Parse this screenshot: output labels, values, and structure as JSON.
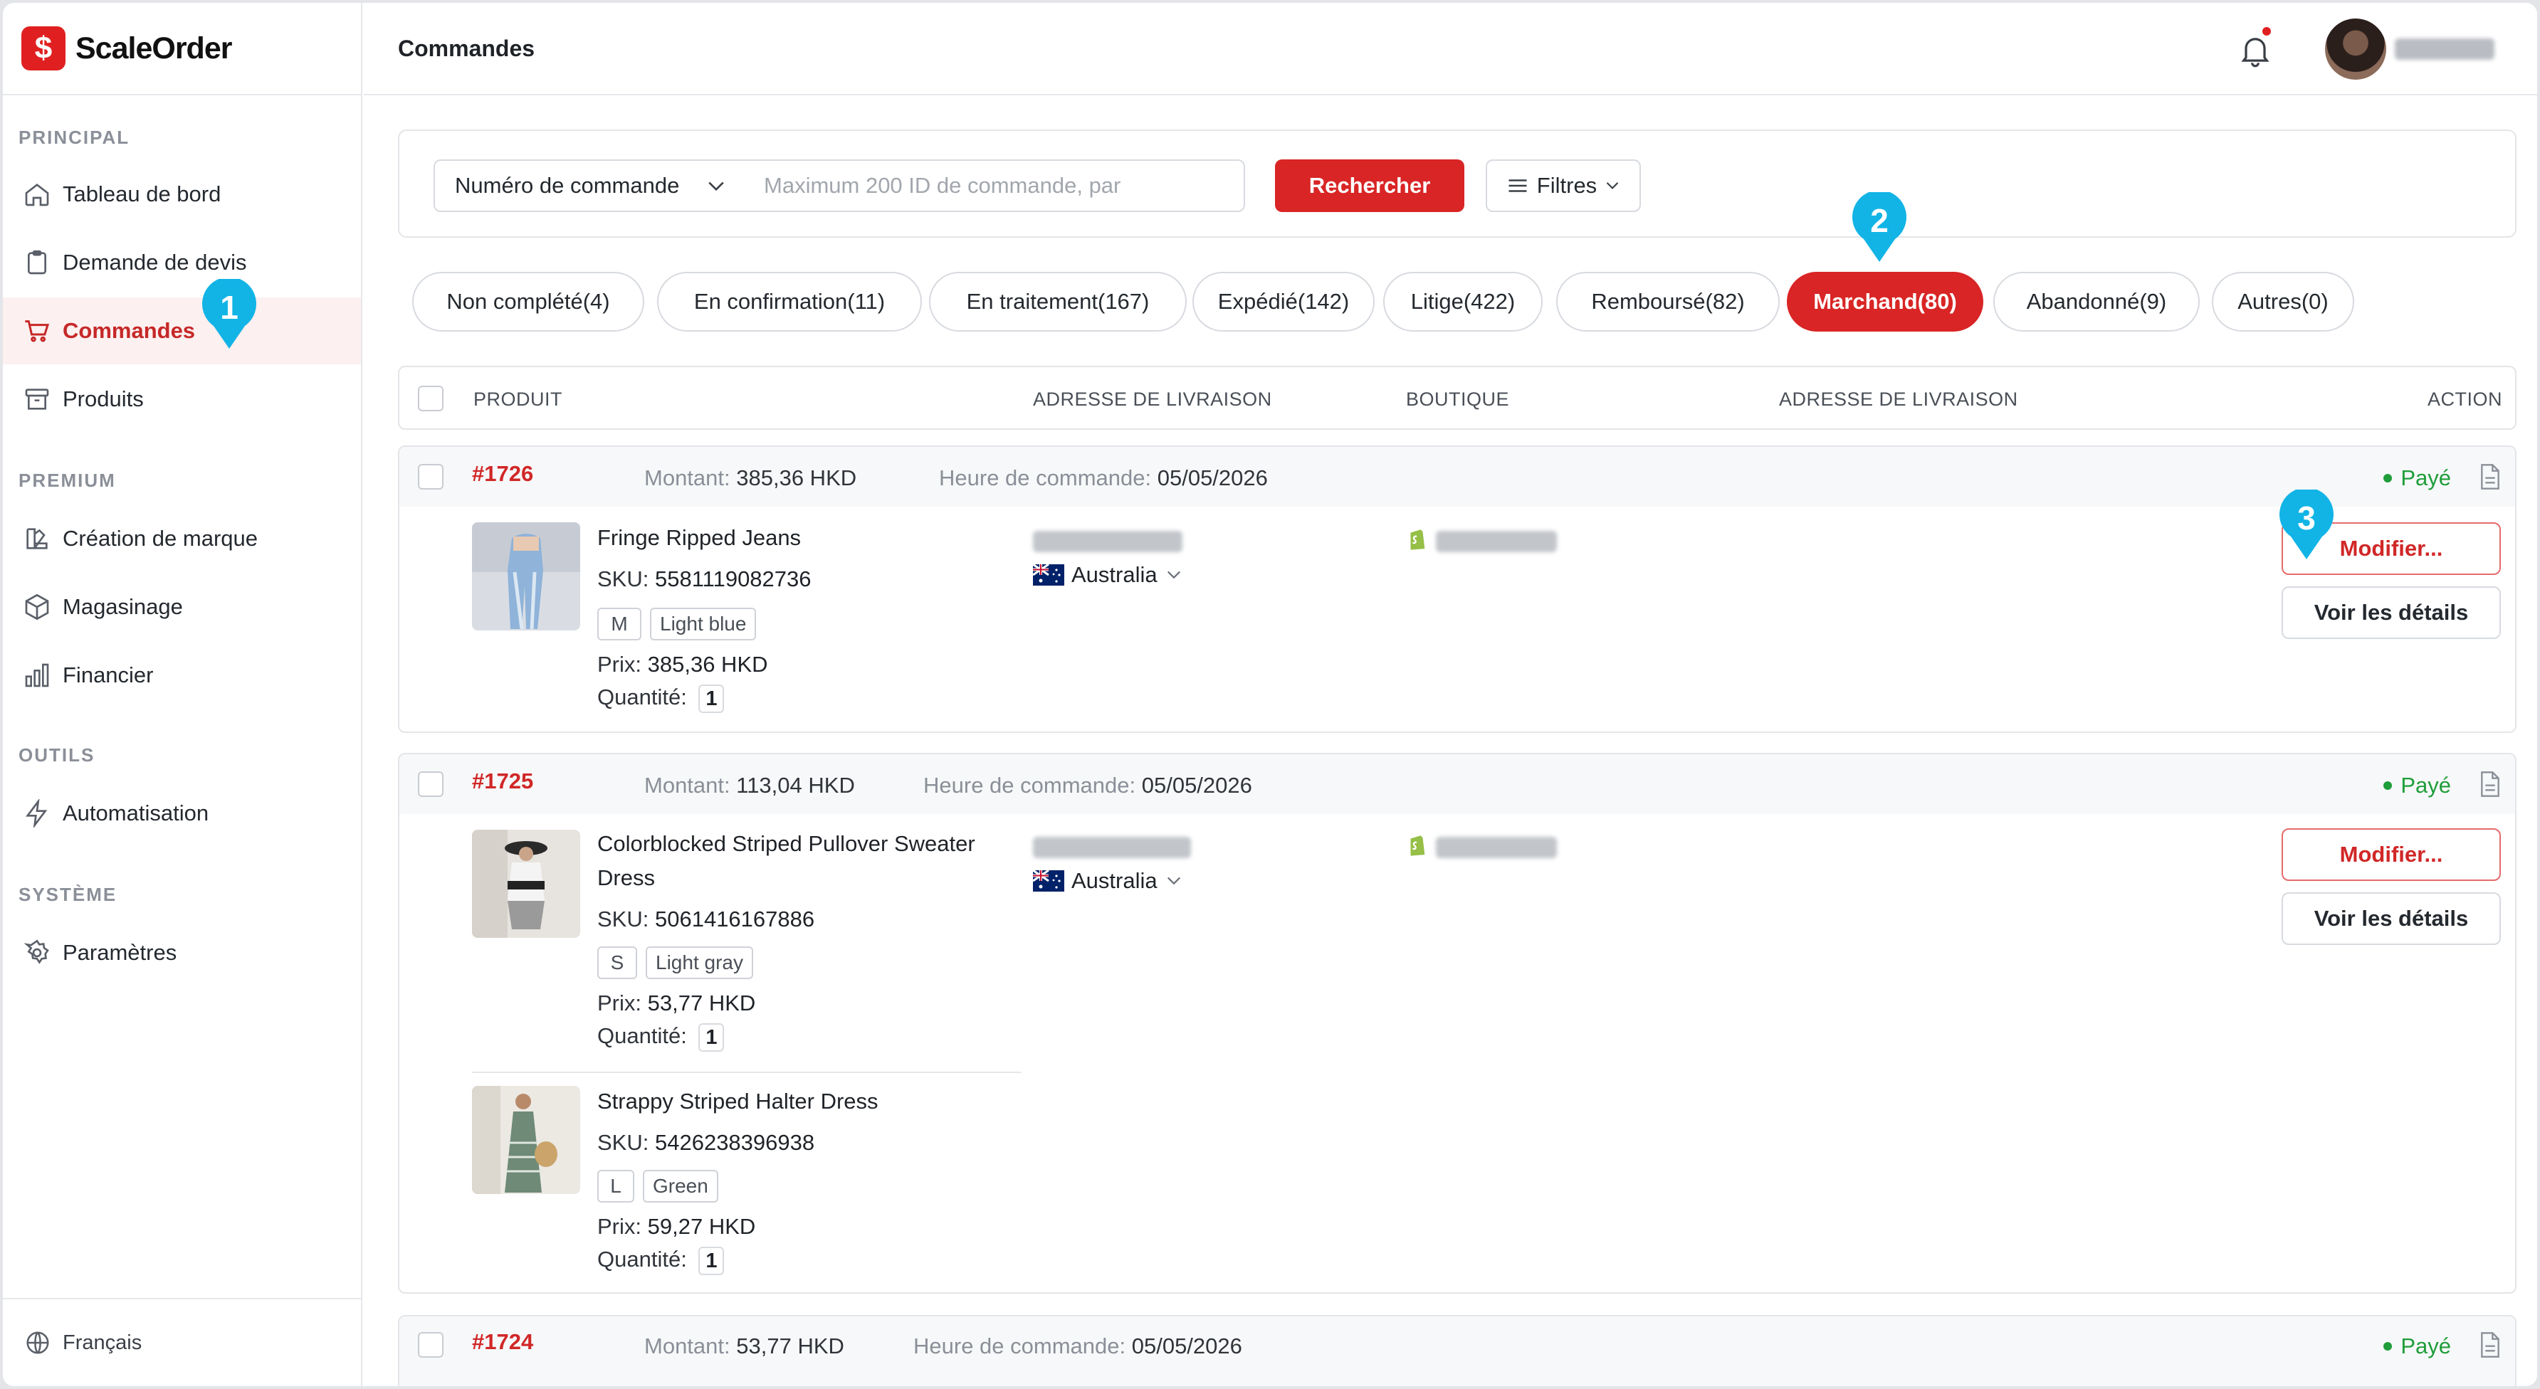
{
  "brand": {
    "name": "ScaleOrder",
    "logo_glyph": "$"
  },
  "sidebar": {
    "sections": [
      {
        "title": "PRINCIPAL"
      },
      {
        "title": "PREMIUM"
      },
      {
        "title": "OUTILS"
      },
      {
        "title": "SYSTÈME"
      }
    ],
    "items": [
      {
        "label": "Tableau de bord",
        "icon": "home-icon"
      },
      {
        "label": "Demande de devis",
        "icon": "clipboard-icon"
      },
      {
        "label": "Commandes",
        "icon": "cart-icon",
        "active": true
      },
      {
        "label": "Produits",
        "icon": "archive-icon"
      },
      {
        "label": "Création de marque",
        "icon": "brand-icon"
      },
      {
        "label": "Magasinage",
        "icon": "box-icon"
      },
      {
        "label": "Financier",
        "icon": "chart-icon"
      },
      {
        "label": "Automatisation",
        "icon": "bolt-icon"
      },
      {
        "label": "Paramètres",
        "icon": "gear-icon"
      }
    ],
    "language": "Français"
  },
  "header": {
    "title": "Commandes"
  },
  "search": {
    "select_label": "Numéro de commande",
    "placeholder": "Maximum 200 ID de commande, par",
    "search_button": "Rechercher",
    "filters_button": "Filtres"
  },
  "tabs": [
    {
      "label": "Non complété(4)"
    },
    {
      "label": "En confirmation(11)"
    },
    {
      "label": "En traitement(167)"
    },
    {
      "label": "Expédié(142)"
    },
    {
      "label": "Litige(422)"
    },
    {
      "label": "Remboursé(82)"
    },
    {
      "label": "Marchand(80)",
      "active": true
    },
    {
      "label": "Abandonné(9)"
    },
    {
      "label": "Autres(0)"
    }
  ],
  "columns": [
    "PRODUIT",
    "ADRESSE DE LIVRAISON",
    "BOUTIQUE",
    "ADRESSE DE LIVRAISON",
    "ACTION"
  ],
  "labels": {
    "amount": "Montant:",
    "order_time": "Heure de commande:",
    "sku": "SKU:",
    "price": "Prix:",
    "quantity": "Quantité:",
    "modify": "Modifier...",
    "details": "Voir les détails"
  },
  "orders": [
    {
      "id": "#1726",
      "amount": "385,36 HKD",
      "time": "05/05/2026",
      "status": "Payé",
      "country": "Australia",
      "products": [
        {
          "name": "Fringe Ripped Jeans",
          "sku": "5581119082736",
          "size": "M",
          "color": "Light blue",
          "price": "385,36 HKD",
          "qty": "1"
        }
      ]
    },
    {
      "id": "#1725",
      "amount": "113,04 HKD",
      "time": "05/05/2026",
      "status": "Payé",
      "country": "Australia",
      "products": [
        {
          "name": "Colorblocked Striped Pullover Sweater Dress",
          "sku": "5061416167886",
          "size": "S",
          "color": "Light gray",
          "price": "53,77 HKD",
          "qty": "1"
        },
        {
          "name": "Strappy Striped Halter Dress",
          "sku": "5426238396938",
          "size": "L",
          "color": "Green",
          "price": "59,27 HKD",
          "qty": "1"
        }
      ]
    },
    {
      "id": "#1724",
      "amount": "53,77 HKD",
      "time": "05/05/2026",
      "status": "Payé"
    }
  ],
  "markers": [
    "1",
    "2",
    "3"
  ],
  "colors": {
    "accent": "#d92525",
    "paid": "#1f9d3a",
    "marker": "#12b4e6"
  }
}
